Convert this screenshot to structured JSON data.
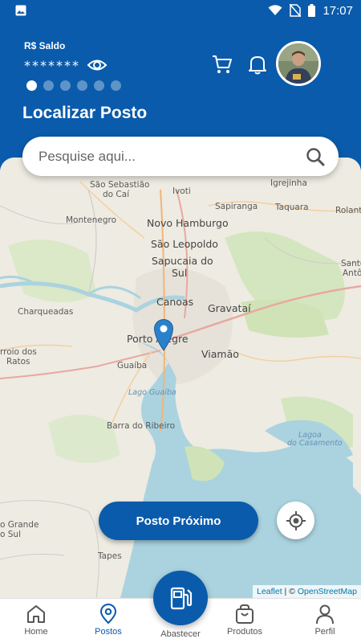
{
  "status_bar": {
    "time": "17:07",
    "icons": [
      "image-icon",
      "wifi-icon",
      "no-sim-icon",
      "battery-icon"
    ]
  },
  "header": {
    "balance_label": "R$ Saldo",
    "balance_value": "*******",
    "carousel": {
      "count": 6,
      "active": 0
    },
    "title": "Localizar Posto"
  },
  "search": {
    "placeholder": "Pesquise aqui..."
  },
  "map": {
    "labels": {
      "sao_sebastiao": "São Sebastião",
      "do_cai": "do Caí",
      "ivoti": "Ivoti",
      "igrejinha": "Igrejinha",
      "sapiranga": "Sapiranga",
      "taquara": "Taquara",
      "rolante": "Rolante",
      "montenegro": "Montenegro",
      "novo_hamburgo": "Novo Hamburgo",
      "sao_leopoldo": "São Leopoldo",
      "sapucaia": "Sapucaia do",
      "sapucaia_2": "Sul",
      "santo": "Santo",
      "anto": "Antô",
      "charqueadas": "Charqueadas",
      "canoas": "Canoas",
      "gravatai": "Gravataí",
      "porto_alegre": "Porto Alegre",
      "viamao": "Viamão",
      "arroio": "rroio dos",
      "ratos": "Ratos",
      "guaiba": "Guaíba",
      "lago_guaiba": "Lago Guaíba",
      "barra": "Barra do Ribeiro",
      "lagoa": "Lagoa",
      "do_casamento": "do Casamento",
      "grande": "o Grande",
      "sul": "o Sul",
      "tapes": "Tapes"
    },
    "attribution_leaflet": "Leaflet",
    "attribution_sep": " | © ",
    "attribution_osm": "OpenStreetMap"
  },
  "actions": {
    "nearest_label": "Posto Próximo"
  },
  "nav": {
    "home": "Home",
    "postos": "Postos",
    "abastecer": "Abastecer",
    "produtos": "Produtos",
    "perfil": "Perfil",
    "active": "postos"
  },
  "colors": {
    "primary": "#0a5bab",
    "map_bg": "#eeebe2",
    "water": "#aad3df",
    "green": "#c8dfae"
  }
}
